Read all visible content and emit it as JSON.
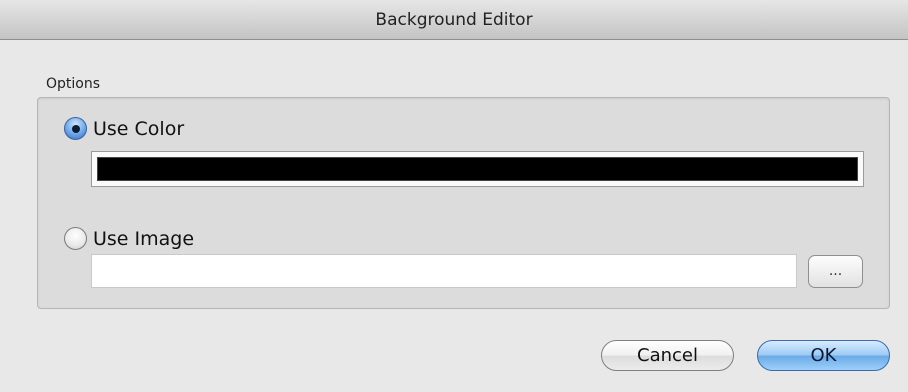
{
  "window": {
    "title": "Background Editor"
  },
  "options": {
    "group_label": "Options",
    "use_color": {
      "label": "Use Color",
      "selected": true,
      "color_value": "#000000"
    },
    "use_image": {
      "label": "Use Image",
      "selected": false,
      "path_value": "",
      "browse_label": "..."
    }
  },
  "buttons": {
    "cancel_label": "Cancel",
    "ok_label": "OK"
  },
  "colors": {
    "ok_accent": "#6aa9e8",
    "radio_accent": "#2f6ac4"
  }
}
